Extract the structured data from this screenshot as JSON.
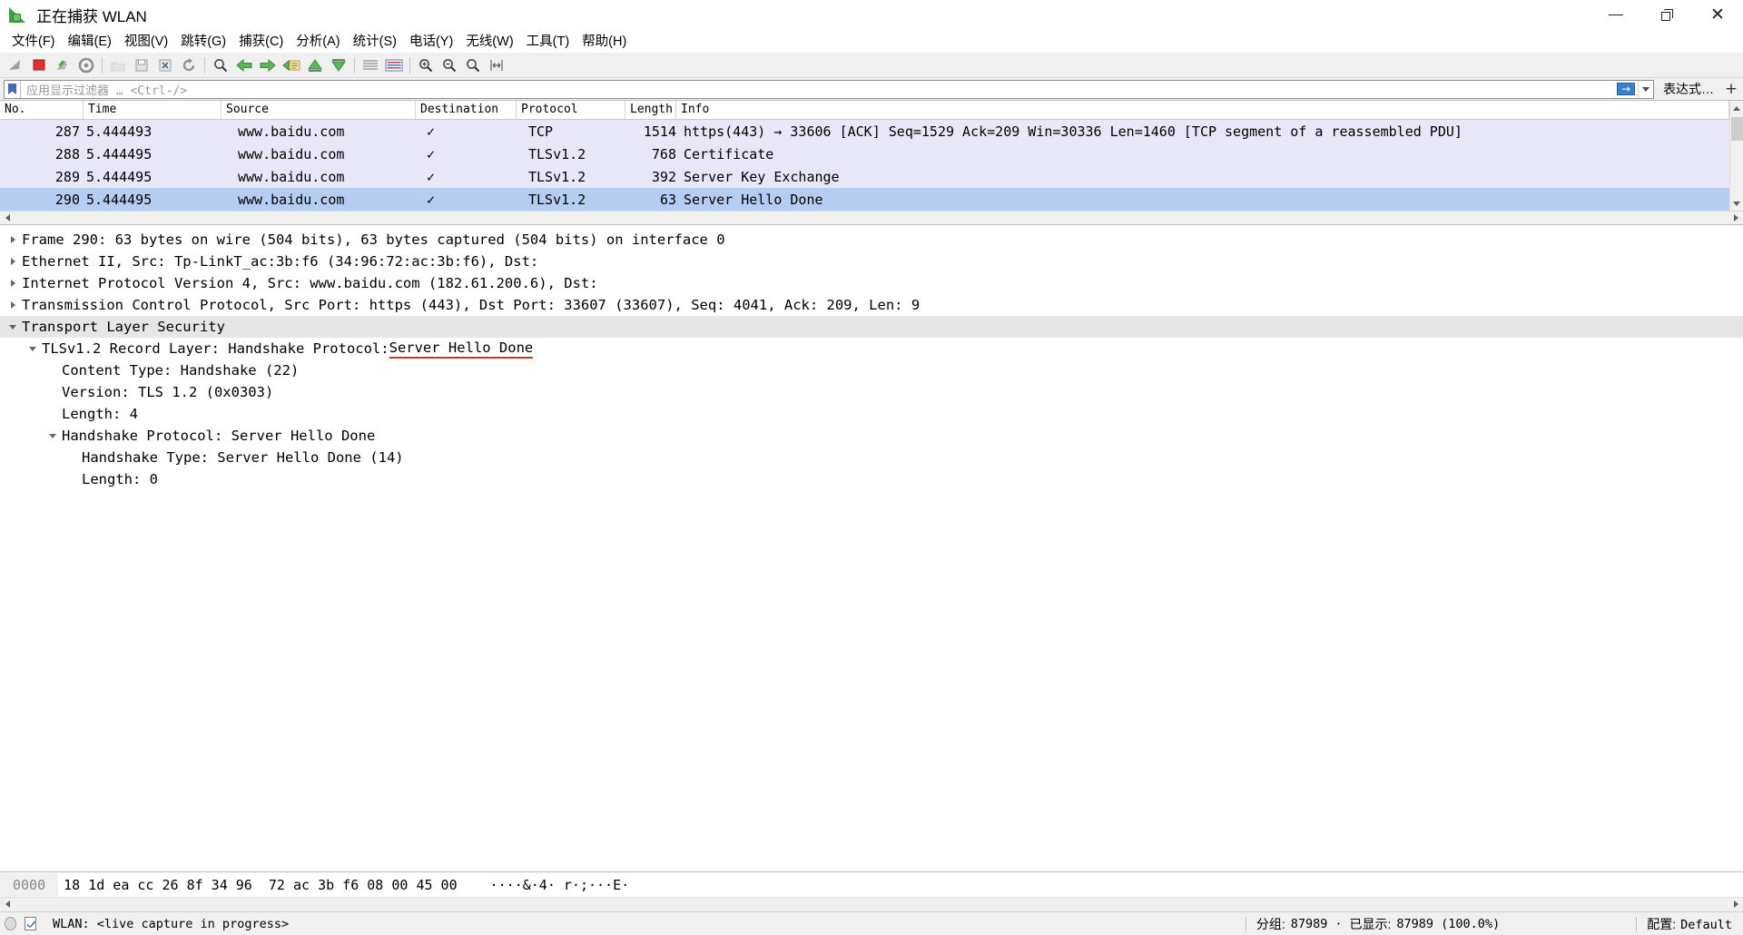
{
  "window": {
    "title": "正在捕获 WLAN",
    "app_icon": "wireshark-shark-fin-icon",
    "minimize_label": "最小化",
    "maximize_label": "最大化",
    "close_label": "关闭"
  },
  "menubar": {
    "items": [
      {
        "label": "文件(F)",
        "name": "menu-file"
      },
      {
        "label": "编辑(E)",
        "name": "menu-edit"
      },
      {
        "label": "视图(V)",
        "name": "menu-view"
      },
      {
        "label": "跳转(G)",
        "name": "menu-go"
      },
      {
        "label": "捕获(C)",
        "name": "menu-capture"
      },
      {
        "label": "分析(A)",
        "name": "menu-analyze"
      },
      {
        "label": "统计(S)",
        "name": "menu-statistics"
      },
      {
        "label": "电话(Y)",
        "name": "menu-telephony"
      },
      {
        "label": "无线(W)",
        "name": "menu-wireless"
      },
      {
        "label": "工具(T)",
        "name": "menu-tools"
      },
      {
        "label": "帮助(H)",
        "name": "menu-help"
      }
    ]
  },
  "toolbar": {
    "buttons": [
      {
        "name": "start-capture-icon",
        "title": "开始捕获"
      },
      {
        "name": "stop-capture-icon",
        "title": "停止捕获"
      },
      {
        "name": "restart-capture-icon",
        "title": "重新开始当前捕获"
      },
      {
        "name": "capture-options-icon",
        "title": "捕获选项"
      },
      {
        "name": "open-file-icon",
        "title": "打开"
      },
      {
        "name": "save-file-icon",
        "title": "保存"
      },
      {
        "name": "close-file-icon",
        "title": "关闭"
      },
      {
        "name": "reload-file-icon",
        "title": "重新加载"
      },
      {
        "name": "find-packet-icon",
        "title": "查找分组"
      },
      {
        "name": "go-back-icon",
        "title": "返回"
      },
      {
        "name": "go-forward-icon",
        "title": "前进"
      },
      {
        "name": "go-to-packet-icon",
        "title": "跳转到分组"
      },
      {
        "name": "go-to-first-icon",
        "title": "跳转到第一个分组"
      },
      {
        "name": "go-to-last-icon",
        "title": "跳转到最后一个分组"
      },
      {
        "name": "auto-scroll-icon",
        "title": "实时捕获时自动滚动"
      },
      {
        "name": "colorize-icon",
        "title": "着色分组列表"
      },
      {
        "name": "zoom-in-icon",
        "title": "放大"
      },
      {
        "name": "zoom-out-icon",
        "title": "缩小"
      },
      {
        "name": "zoom-reset-icon",
        "title": "正常大小"
      },
      {
        "name": "resize-columns-icon",
        "title": "调整列宽度"
      }
    ]
  },
  "filterbar": {
    "bookmark_icon": "filter-bookmark-icon",
    "placeholder": "应用显示过滤器 … <Ctrl-/>",
    "value": "",
    "apply_icon": "apply-filter-arrow-icon",
    "dropdown_icon": "chevron-down-icon",
    "expression_label": "表达式…",
    "add_label": "+"
  },
  "packet_list": {
    "columns": [
      {
        "label": "No.",
        "name": "column-no"
      },
      {
        "label": "Time",
        "name": "column-time"
      },
      {
        "label": "Source",
        "name": "column-source"
      },
      {
        "label": "Destination",
        "name": "column-destination"
      },
      {
        "label": "Protocol",
        "name": "column-protocol"
      },
      {
        "label": "Length",
        "name": "column-length"
      },
      {
        "label": "Info",
        "name": "column-info"
      }
    ],
    "rows": [
      {
        "no": "287",
        "time": "5.444493",
        "source": "www.baidu.com",
        "destination": "✓",
        "protocol": "TCP",
        "length": "1514",
        "info": "https(443) → 33606 [ACK] Seq=1529 Ack=209 Win=30336 Len=1460 [TCP segment of a reassembled PDU]",
        "selected": false
      },
      {
        "no": "288",
        "time": "5.444495",
        "source": "www.baidu.com",
        "destination": "✓",
        "protocol": "TLSv1.2",
        "length": "768",
        "info": "Certificate",
        "selected": false
      },
      {
        "no": "289",
        "time": "5.444495",
        "source": "www.baidu.com",
        "destination": "✓",
        "protocol": "TLSv1.2",
        "length": "392",
        "info": "Server Key Exchange",
        "selected": false
      },
      {
        "no": "290",
        "time": "5.444495",
        "source": "www.baidu.com",
        "destination": "✓",
        "protocol": "TLSv1.2",
        "length": "63",
        "info": "Server Hello Done",
        "selected": true
      }
    ]
  },
  "detail_tree": [
    {
      "name": "frame-node",
      "indent": 0,
      "twisty": "collapsed",
      "text": "Frame 290: 63 bytes on wire (504 bits), 63 bytes captured (504 bits) on interface 0"
    },
    {
      "name": "ethernet-node",
      "indent": 0,
      "twisty": "collapsed",
      "text": "Ethernet II, Src: Tp-LinkT_ac:3b:f6 (34:96:72:ac:3b:f6), Dst:",
      "redacted_width": 286
    },
    {
      "name": "ipv4-node",
      "indent": 0,
      "twisty": "collapsed",
      "text": "Internet Protocol Version 4, Src: www.baidu.com (182.61.200.6), Dst:",
      "redacted_width": 252
    },
    {
      "name": "tcp-node",
      "indent": 0,
      "twisty": "collapsed",
      "text": "Transmission Control Protocol, Src Port: https (443), Dst Port: 33607 (33607), Seq: 4041, Ack: 209, Len: 9"
    },
    {
      "name": "tls-node",
      "indent": 0,
      "twisty": "expanded",
      "text": "Transport Layer Security",
      "highlight": true
    },
    {
      "name": "tls-record-layer-node",
      "indent": 1,
      "twisty": "expanded",
      "text": "TLSv1.2 Record Layer: Handshake Protocol: ",
      "underlined_tail": "Server Hello Done"
    },
    {
      "name": "content-type-node",
      "indent": 2,
      "twisty": "none",
      "text": "Content Type: Handshake (22)"
    },
    {
      "name": "version-node",
      "indent": 2,
      "twisty": "none",
      "text": "Version: TLS 1.2 (0x0303)"
    },
    {
      "name": "record-length-node",
      "indent": 2,
      "twisty": "none",
      "text": "Length: 4"
    },
    {
      "name": "handshake-protocol-node",
      "indent": 2,
      "twisty": "expanded",
      "text": "Handshake Protocol: Server Hello Done"
    },
    {
      "name": "handshake-type-node",
      "indent": 3,
      "twisty": "none",
      "text": "Handshake Type: Server Hello Done (14)"
    },
    {
      "name": "handshake-length-node",
      "indent": 3,
      "twisty": "none",
      "text": "Length: 0"
    }
  ],
  "hex_pane": {
    "rows": [
      {
        "offset": "0000",
        "bytes": "18 1d ea cc 26 8f 34 96  72 ac 3b f6 08 00 45 00",
        "ascii": "····&·4· r·;···E·"
      }
    ]
  },
  "statusbar": {
    "capture_icon": "capture-status-icon",
    "expert_icon": "expert-info-icon",
    "capture_text": "WLAN: <live capture in progress>",
    "packets_label": "分组:",
    "packets_value": "87989",
    "separator_dot": "·",
    "displayed_label": "已显示:",
    "displayed_value": "87989 (100.0%)",
    "profile_label": "配置:",
    "profile_value": "Default"
  }
}
